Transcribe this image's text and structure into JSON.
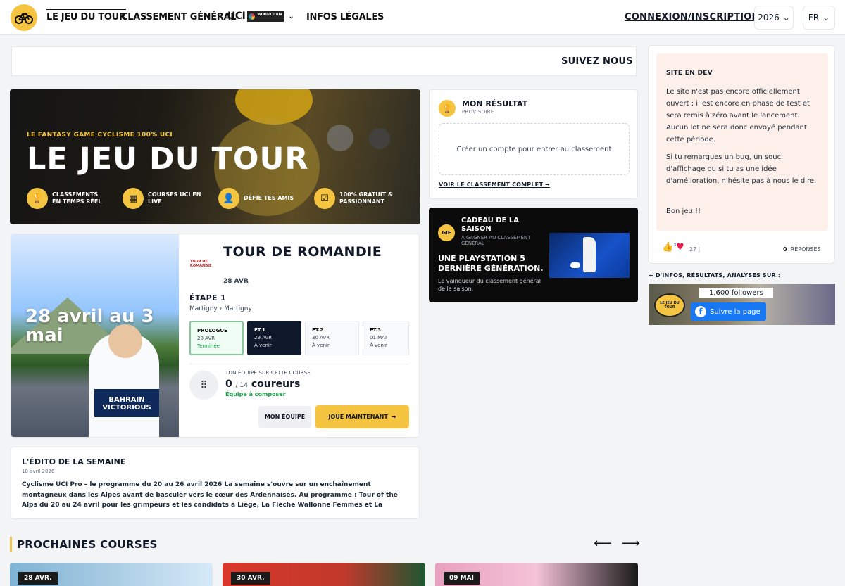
{
  "header": {
    "nav": [
      "LE JEU DU TOUR",
      "CLASSEMENT GÉNÉRAL",
      "INFOS LÉGALES"
    ],
    "uci_label": "UCI",
    "world_tour_label": "WORLD TOUR",
    "login": "CONNEXION/INSCRIPTION",
    "year": "2026",
    "lang": "FR"
  },
  "ticker": "SUIVEZ NOUS SI",
  "hero": {
    "tagline": "LE FANTASY GAME CYCLISME 100% UCI",
    "title": "LE JEU DU TOUR",
    "features": [
      "CLASSEMENTS EN TEMPS RÉEL",
      "COURSES UCI EN LIVE",
      "DÉFIE TES AMIS",
      "100% GRATUIT & PASSIONNANT"
    ]
  },
  "result": {
    "title": "MON RÉSULTAT",
    "subtitle": "PROVISOIRE",
    "cta": "Créer un compte pour entrer au classement",
    "link": "VOIR LE CLASSEMENT COMPLET"
  },
  "gift": {
    "badge": "GIF",
    "title": "CADEAU DE LA SAISON",
    "subtitle": "À GAGNER AU CLASSEMENT GÉNÉRAL",
    "prize": "UNE PLAYSTATION 5 DERNIÈRE GÉNÉRATION.",
    "desc": "Le vainqueur du classement général de la saison."
  },
  "race": {
    "image_dates": "28 avril au 3 mai",
    "image_jersey": "BAHRAIN VICTORIOUS",
    "logo": "TOUR DE ROMANDIE",
    "title": "TOUR DE ROMANDIE",
    "date": "28 AVR",
    "stage": "ÉTAPE 1",
    "route": "Martigny › Martigny",
    "stages": [
      {
        "name": "PROLOGUE",
        "date": "28 AVR",
        "status": "Terminée"
      },
      {
        "name": "ET.1",
        "date": "29 AVR",
        "status": "À venir"
      },
      {
        "name": "ET.2",
        "date": "30 AVR",
        "status": "À venir"
      },
      {
        "name": "ET.3",
        "date": "01 MAI",
        "status": "À venir"
      }
    ],
    "team_label": "TON ÉQUIPE SUR CETTE COURSE",
    "count": "0",
    "count_total": "/ 14",
    "count_unit": "coureurs",
    "team_status": "Équipe à composer",
    "btn_team": "MON ÉQUIPE",
    "btn_play": "JOUE MAINTENANT"
  },
  "edito": {
    "title": "L'ÉDITO DE LA SEMAINE",
    "date": "18 avril 2026",
    "text": "Cyclisme UCI Pro – le programme du 20 au 26 avril 2026 La semaine s'ouvre sur un enchaînement montagneux dans les Alpes avant de basculer vers le cœur des Ardennaises. Au programme : Tour of the Alps du 20 au 24 avril pour les grimpeurs et les candidats à Liège, La Flèche Wallonne Femmes et La Flèche…"
  },
  "upcoming": {
    "title": "PROCHAINES COURSES",
    "cards": [
      "28 AVR.",
      "30 AVR.",
      "09 MAI"
    ]
  },
  "sidebar": {
    "title": "SITE EN DEV",
    "p1": "Le site n'est pas encore officiellement ouvert : il est encore en phase de test et sera remis à zéro avant le lancement. Aucun lot ne sera donc envoyé pendant cette période.",
    "p2": "Si tu remarques un bug, un souci d'affichage ou si tu as une idée d'amélioration, n'hésite pas à nous le dire.",
    "p3": "Bon jeu !!",
    "reactions_count": "3",
    "time": "27 j",
    "replies_count": "0",
    "replies_label": "RÉPONSES",
    "social_title": "+ D'INFOS, RÉSULTATS, ANALYSES SUR :",
    "fb_logo": "LE JEU DU TOUR",
    "followers": "1,600 followers",
    "fb_button": "Suivre la page"
  }
}
